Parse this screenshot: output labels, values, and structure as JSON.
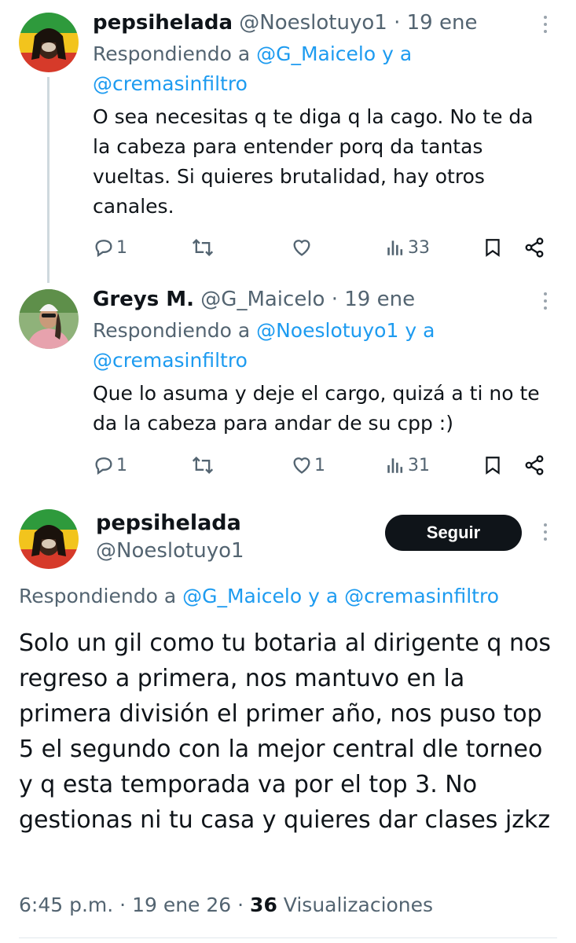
{
  "replies": [
    {
      "name": "pepsihelada",
      "handle": "@Noeslotuyo1",
      "sep": "·",
      "date": "19 ene",
      "replying_prefix": "Respondiendo a",
      "mention1": "@G_Maicelo",
      "connector": "y a",
      "mention2": "@cremasinfiltro",
      "text_lines": [
        "O sea necesitas q te diga q la cago. No te da",
        "la cabeza para entender porq da tantas",
        "vueltas. Si quieres brutalidad, hay otros",
        "canales."
      ],
      "reply_count": "1",
      "retweet_count": "",
      "like_count": "",
      "view_count": "33"
    },
    {
      "name": "Greys M.",
      "handle": "@G_Maicelo",
      "sep": "·",
      "date": "19 ene",
      "replying_prefix": "Respondiendo a",
      "mention1": "@Noeslotuyo1",
      "connector": "y a",
      "mention2": "@cremasinfiltro",
      "text_lines": [
        "Que lo asuma y deje el cargo, quizá a ti no te",
        "da la cabeza para andar de su cpp  :)"
      ],
      "reply_count": "1",
      "retweet_count": "",
      "like_count": "1",
      "view_count": "31"
    }
  ],
  "main": {
    "name": "pepsihelada",
    "handle": "@Noeslotuyo1",
    "follow_label": "Seguir",
    "replying_prefix": "Respondiendo a",
    "mention1": "@G_Maicelo",
    "connector": "y a",
    "mention2": "@cremasinfiltro",
    "text": "Solo un gil como tu botaria al dirigente q nos regreso a primera, nos mantuvo en la primera división el primer año, nos puso top 5 el segundo con la mejor central dle torneo y q esta temporada va por el top 3. No gestionas ni tu casa y quieres dar clases jzkz",
    "time": "6:45 p.m.",
    "sep": "·",
    "date": "19 ene 26",
    "views": "36",
    "views_label": "Visualizaciones"
  },
  "colors": {
    "accent": "#1d9bf0",
    "text": "#0f1419",
    "muted": "#536471",
    "button": "#0f1419"
  },
  "icons": [
    "reply-icon",
    "retweet-icon",
    "like-icon",
    "views-icon",
    "bookmark-icon",
    "share-icon",
    "more-icon"
  ]
}
